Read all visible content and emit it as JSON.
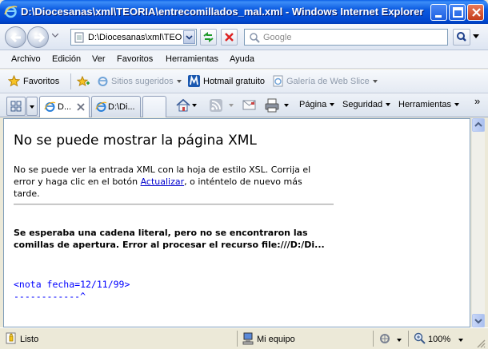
{
  "window": {
    "title": "D:\\Diocesanas\\xml\\TEORIA\\entrecomillados_mal.xml - Windows Internet Explorer"
  },
  "address": {
    "url": "D:\\Diocesanas\\xml\\TEORIA",
    "search_placeholder": "Google"
  },
  "menu": [
    "Archivo",
    "Edición",
    "Ver",
    "Favoritos",
    "Herramientas",
    "Ayuda"
  ],
  "favorites": {
    "label": "Favoritos",
    "suggested": "Sitios sugeridos",
    "hotmail": "Hotmail gratuito",
    "gallery": "Galería de Web Slice"
  },
  "tabs": {
    "tab1": "D...",
    "tab2": "D:\\Di..."
  },
  "tools": {
    "page": "Página",
    "security": "Seguridad",
    "tools": "Herramientas",
    "more": "»"
  },
  "page": {
    "heading": "No se puede mostrar la página XML",
    "body_before": "No se puede ver la entrada XML con la hoja de estilo XSL. Corrija el error y haga clic en el botón ",
    "body_link": "Actualizar",
    "body_after": ", o inténtelo de nuevo más tarde.",
    "error": "Se esperaba una cadena literal, pero no se encontraron las comillas de apertura. Error al procesar el recurso file:///D:/Di...",
    "source_line": "<nota fecha=12/11/99>",
    "pointer_line": "------------^"
  },
  "status": {
    "left": "Listo",
    "zone": "Mi equipo",
    "zoom": "100%"
  },
  "colors": {
    "titlebar": "#0b5ae0",
    "link": "#0000cc",
    "source": "#0000ff"
  }
}
